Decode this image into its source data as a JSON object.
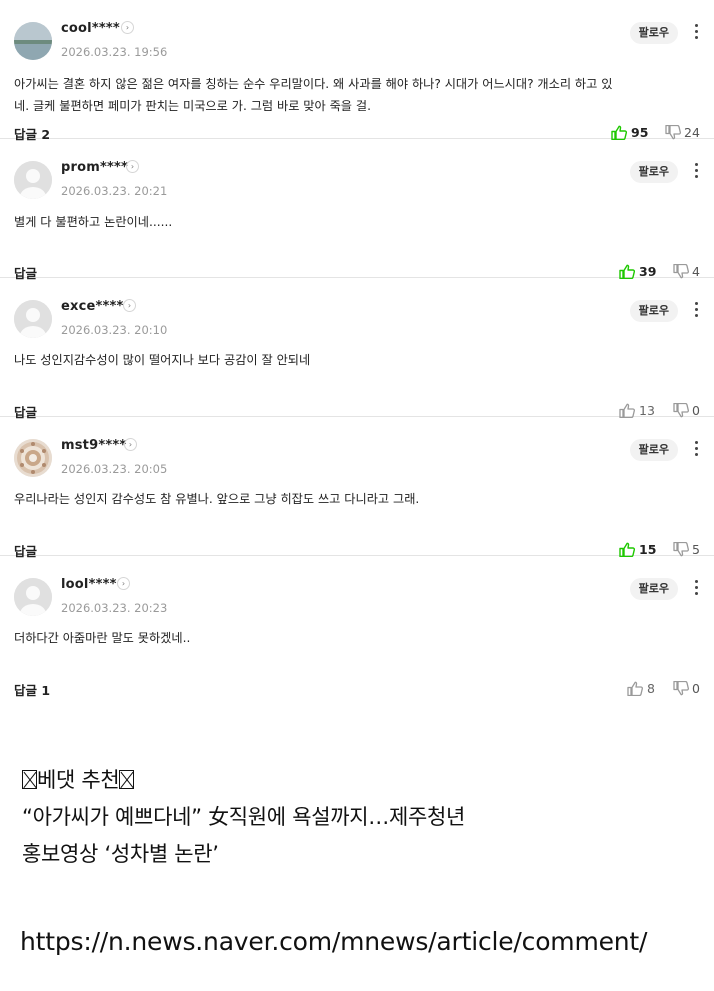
{
  "comments": [
    {
      "username": "cool****",
      "timestamp": "2026.03.23. 19:56",
      "follow_label": "팔로우",
      "body_line1": "아가씨는 결혼 하지 않은 젊은 여자를 칭하는 순수 우리말이다. 왜 사과를 해야 하나? 시대가 어느시대? 개소리 하고 있",
      "body_line2": "네. 글케 불편하면 페미가 판치는 미국으로 가. 그럼 바로 맞아 죽을 걸.",
      "reply_label": "답글 2",
      "likes": "95",
      "dislikes": "24",
      "avatar": "landscape-photo",
      "liked_active": true
    },
    {
      "username": "prom****",
      "timestamp": "2026.03.23. 20:21",
      "follow_label": "팔로우",
      "body_line1": "별게 다 불편하고 논란이네......",
      "body_line2": "",
      "reply_label": "답글",
      "likes": "39",
      "dislikes": "4",
      "avatar": "default-user",
      "liked_active": true
    },
    {
      "username": "exce****",
      "timestamp": "2026.03.23. 20:10",
      "follow_label": "팔로우",
      "body_line1": "나도 성인지감수성이 많이 떨어지나 보다 공감이 잘 안되네",
      "body_line2": "",
      "reply_label": "답글",
      "likes": "13",
      "dislikes": "0",
      "avatar": "default-user",
      "liked_active": false
    },
    {
      "username": "mst9****",
      "timestamp": "2026.03.23. 20:05",
      "follow_label": "팔로우",
      "body_line1": "우리나라는 성인지 감수성도 참 유별나. 앞으로 그냥 히잡도 쓰고 다니라고 그래.",
      "body_line2": "",
      "reply_label": "답글",
      "likes": "15",
      "dislikes": "5",
      "avatar": "pattern-photo",
      "liked_active": true
    },
    {
      "username": "lool****",
      "timestamp": "2026.03.23. 20:23",
      "follow_label": "팔로우",
      "body_line1": "더하다간 아줌마란 말도 못하겠네..",
      "body_line2": "",
      "reply_label": "답글 1",
      "likes": "8",
      "dislikes": "0",
      "avatar": "default-user",
      "liked_active": false
    }
  ],
  "recommend": {
    "header": "베댓 추천",
    "title_line1": "“아가씨가 예쁘다네” 女직원에 욕설까지…제주청년",
    "title_line2": "홍보영상 ‘성차별 논란’"
  },
  "url": "https://n.news.naver.com/mnews/article/comment/",
  "colors": {
    "like_active": "#1ec800",
    "muted_icon": "#9a9a9a",
    "follow_bg": "#f2f2f2",
    "divider": "#e4e4e4"
  },
  "icons": {
    "like": "thumbs-up-icon",
    "dislike": "thumbs-down-icon",
    "more": "more-vertical-icon",
    "chevron": "chevron-right-icon",
    "broken_glyph": "missing-glyph-box-icon"
  }
}
